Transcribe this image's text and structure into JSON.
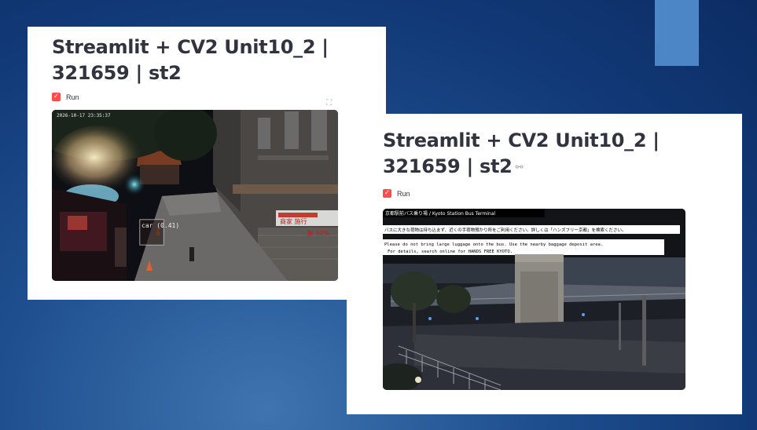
{
  "left_card": {
    "title": "Streamlit + CV2 Unit10_2 | 321659 | st2",
    "run_label": "Run",
    "run_checked": true,
    "video": {
      "timestamp": "2026-10-17 23:35:37",
      "detection_label": "car (0.41)",
      "sign_text": "商家 施行",
      "sign_text_2": "鮮 50%"
    }
  },
  "right_card": {
    "title": "Streamlit + CV2 Unit10_2 | 321659 | st2",
    "run_label": "Run",
    "run_checked": true,
    "video": {
      "header": "京都駅前バス乗り場 / Kyoto Station Bus Terminal",
      "notice_jp": "バスに大きな荷物は持ち込まず、近くの手荷物預かり所をご利用ください。詳しくは「ハンズフリー京都」を検索ください。",
      "notice_en_1": "Please do not bring large luggage onto the bus. Use the nearby baggage deposit area.",
      "notice_en_2": "For details, search online for HANDS FREE KYOTO."
    }
  },
  "colors": {
    "checkbox": "#ff4b4b",
    "title_text": "#31333f",
    "accent_rect": "#4d86c6",
    "background": "#1f4f8f"
  },
  "icons": [
    "checkbox-checked-icon",
    "fullscreen-icon",
    "link-icon"
  ]
}
